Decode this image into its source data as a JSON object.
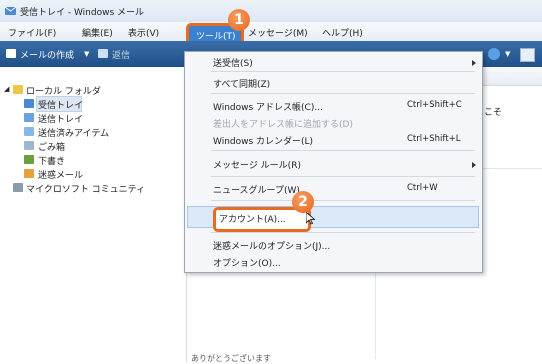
{
  "window": {
    "title": "受信トレイ - Windows メール"
  },
  "menubar": {
    "items": [
      "ファイル(F)",
      "編集(E)",
      "表示(V)"
    ],
    "tools": "ツール(T)",
    "message": "メッセージ(M)",
    "help": "ヘルプ(H)"
  },
  "toolbar": {
    "new_mail": "メールの作成",
    "reply": "返信"
  },
  "folders": {
    "local": "ローカル フォルダ",
    "items": [
      "受信トレイ",
      "送信トレイ",
      "送信済みアイテム",
      "ごみ箱",
      "下書き",
      "迷惑メール"
    ],
    "newsgroup": "マイクロソフト コミュニティ"
  },
  "right": {
    "partial_text": "こそ",
    "status_partial": "ありがとうございます"
  },
  "dropdown": {
    "send_receive": "送受信(S)",
    "sync_all": "すべて同期(Z)",
    "address_book": "Windows アドレス帳(C)...",
    "address_book_sc": "Ctrl+Shift+C",
    "add_sender": "差出人をアドレス帳に追加する(D)",
    "calendar": "Windows カレンダー(L)",
    "calendar_sc": "Ctrl+Shift+L",
    "message_rules": "メッセージ ルール(R)",
    "newsgroups": "ニュースグループ(W)",
    "newsgroups_sc": "Ctrl+W",
    "accounts": "アカウント(A)...",
    "junk_options": "迷惑メールのオプション(J)...",
    "options": "オプション(O)..."
  },
  "badges": {
    "one": "1",
    "two": "2"
  },
  "colors": {
    "highlight": "#3b7fcf",
    "callout": "#ea6a1f",
    "toolbar": "#1e4f88"
  }
}
